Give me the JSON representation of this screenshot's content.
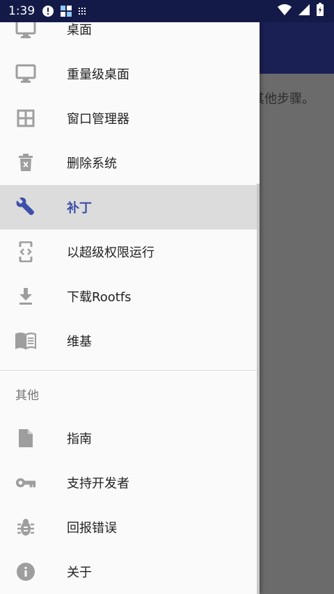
{
  "status_bar": {
    "time": "1:39"
  },
  "background": {
    "partial_text": "其他步骤。"
  },
  "drawer": {
    "items": [
      {
        "label": "桌面",
        "icon": "monitor-icon"
      },
      {
        "label": "重量级桌面",
        "icon": "monitor-icon"
      },
      {
        "label": "窗口管理器",
        "icon": "grid-icon"
      },
      {
        "label": "删除系统",
        "icon": "trash-icon"
      },
      {
        "label": "补丁",
        "icon": "wrench-icon",
        "active": true
      },
      {
        "label": "以超级权限运行",
        "icon": "code-phone-icon"
      },
      {
        "label": "下载Rootfs",
        "icon": "download-icon"
      },
      {
        "label": "维基",
        "icon": "book-icon"
      }
    ],
    "section_header": "其他",
    "other_items": [
      {
        "label": "指南",
        "icon": "document-icon"
      },
      {
        "label": "支持开发者",
        "icon": "key-icon"
      },
      {
        "label": "回报错误",
        "icon": "bug-icon"
      },
      {
        "label": "关于",
        "icon": "info-icon"
      }
    ]
  },
  "colors": {
    "status_bar": "#141a47",
    "app_bar": "#1b2054",
    "accent": "#3c4fa8",
    "active_bg": "#dcdcdc",
    "icon": "#9e9e9e"
  }
}
